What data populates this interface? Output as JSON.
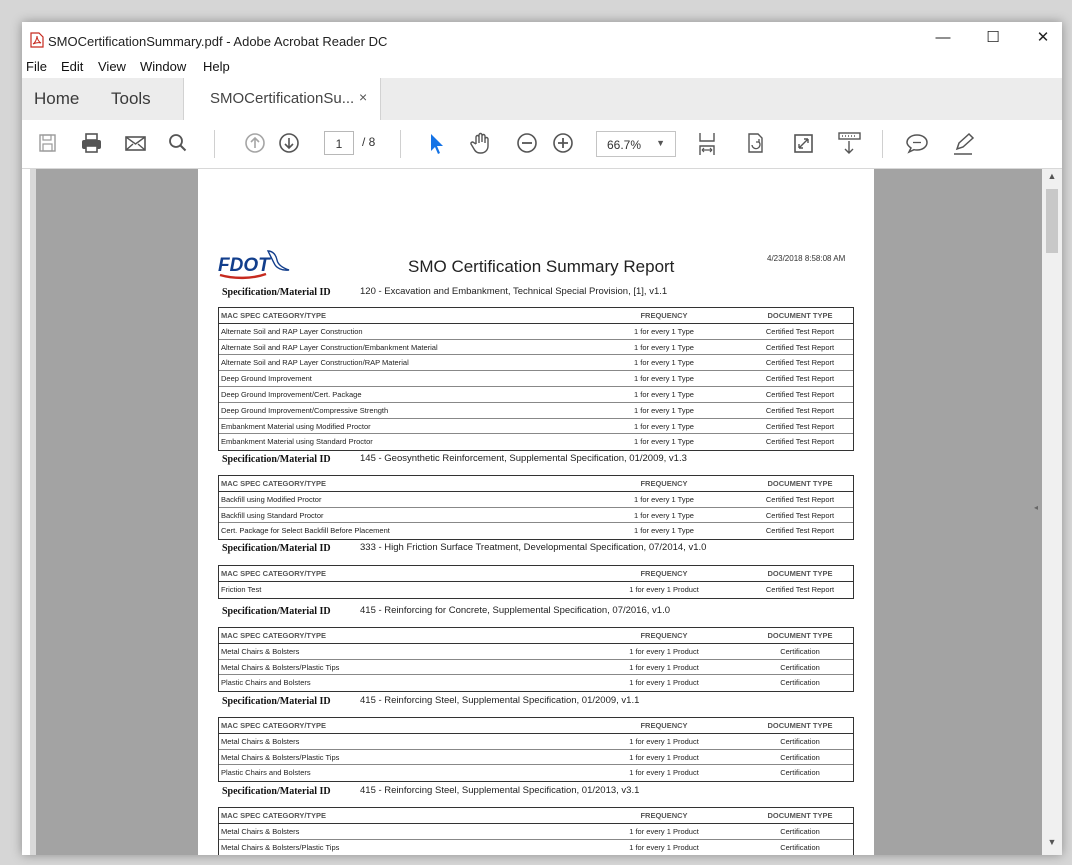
{
  "window": {
    "title": "SMOCertificationSummary.pdf - Adobe Acrobat Reader DC",
    "minimize": "—",
    "maximize": "☐",
    "close": "✕"
  },
  "menu": [
    "File",
    "Edit",
    "View",
    "Window",
    "Help"
  ],
  "tabs": {
    "home": "Home",
    "tools": "Tools",
    "document": "SMOCertificationSu...",
    "document_close": "×"
  },
  "toolbar": {
    "icons": [
      "save-icon",
      "print-icon",
      "email-icon",
      "search-icon",
      "previous-page-icon",
      "next-page-icon",
      "select-pointer-icon",
      "hand-tool-icon",
      "zoom-out-icon",
      "zoom-in-icon",
      "fit-page-icon",
      "rotate-icon",
      "full-screen-icon",
      "scroll-mode-icon",
      "comment-icon",
      "sign-icon"
    ],
    "page_current": "1",
    "page_total": "/ 8",
    "zoom": "66.7%",
    "accent_color": "#1473e6"
  },
  "document": {
    "logo_text": "FDOT",
    "report_title": "SMO Certification Summary Report",
    "report_date": "4/23/2018 8:58:08 AM",
    "column_headers": {
      "category": "MAC SPEC CATEGORY/TYPE",
      "frequency": "FREQUENCY",
      "document_type": "DOCUMENT TYPE"
    },
    "sections": [
      {
        "label": "Specification/Material ID",
        "value": "120 - Excavation and Embankment, Technical Special Provision, [1], v1.1",
        "rows": [
          [
            "Alternate Soil and RAP Layer Construction",
            "1 for every 1 Type",
            "Certified Test Report"
          ],
          [
            "Alternate Soil and RAP Layer Construction/Embankment Material",
            "1 for every 1 Type",
            "Certified Test Report"
          ],
          [
            "Alternate Soil and RAP Layer Construction/RAP Material",
            "1 for every 1 Type",
            "Certified Test Report"
          ],
          [
            "Deep Ground Improvement",
            "1 for every 1 Type",
            "Certified Test Report"
          ],
          [
            "Deep Ground Improvement/Cert. Package",
            "1 for every 1 Type",
            "Certified Test Report"
          ],
          [
            "Deep Ground Improvement/Compressive Strength",
            "1 for every 1 Type",
            "Certified Test Report"
          ],
          [
            "Embankment Material using Modified Proctor",
            "1 for every 1 Type",
            "Certified Test Report"
          ],
          [
            "Embankment Material using Standard Proctor",
            "1 for every 1 Type",
            "Certified Test Report"
          ]
        ]
      },
      {
        "label": "Specification/Material ID",
        "value": "145 - Geosynthetic Reinforcement, Supplemental Specification, 01/2009, v1.3",
        "rows": [
          [
            "Backfill using Modified Proctor",
            "1 for every 1 Type",
            "Certified Test Report"
          ],
          [
            "Backfill using Standard Proctor",
            "1 for every 1 Type",
            "Certified Test Report"
          ],
          [
            "Cert. Package for Select Backfill Before Placement",
            "1 for every 1 Type",
            "Certified Test Report"
          ]
        ]
      },
      {
        "label": "Specification/Material ID",
        "value": "333 - High Friction Surface Treatment, Developmental Specification, 07/2014, v1.0",
        "rows": [
          [
            "Friction Test",
            "1 for every 1 Product",
            "Certified Test Report"
          ]
        ]
      },
      {
        "label": "Specification/Material ID",
        "value": "415 - Reinforcing for Concrete, Supplemental Specification, 07/2016, v1.0",
        "rows": [
          [
            "Metal Chairs & Bolsters",
            "1 for every 1 Product",
            "Certification"
          ],
          [
            "Metal Chairs & Bolsters/Plastic Tips",
            "1 for every 1 Product",
            "Certification"
          ],
          [
            "Plastic Chairs and Bolsters",
            "1 for every 1 Product",
            "Certification"
          ]
        ]
      },
      {
        "label": "Specification/Material ID",
        "value": "415 - Reinforcing Steel, Supplemental Specification, 01/2009, v1.1",
        "rows": [
          [
            "Metal Chairs & Bolsters",
            "1 for every 1 Product",
            "Certification"
          ],
          [
            "Metal Chairs & Bolsters/Plastic Tips",
            "1 for every 1 Product",
            "Certification"
          ],
          [
            "Plastic Chairs and Bolsters",
            "1 for every 1 Product",
            "Certification"
          ]
        ]
      },
      {
        "label": "Specification/Material ID",
        "value": "415 - Reinforcing Steel, Supplemental Specification, 01/2013, v3.1",
        "rows": [
          [
            "Metal Chairs & Bolsters",
            "1 for every 1 Product",
            "Certification"
          ],
          [
            "Metal Chairs & Bolsters/Plastic Tips",
            "1 for every 1 Product",
            "Certification"
          ]
        ]
      }
    ]
  }
}
